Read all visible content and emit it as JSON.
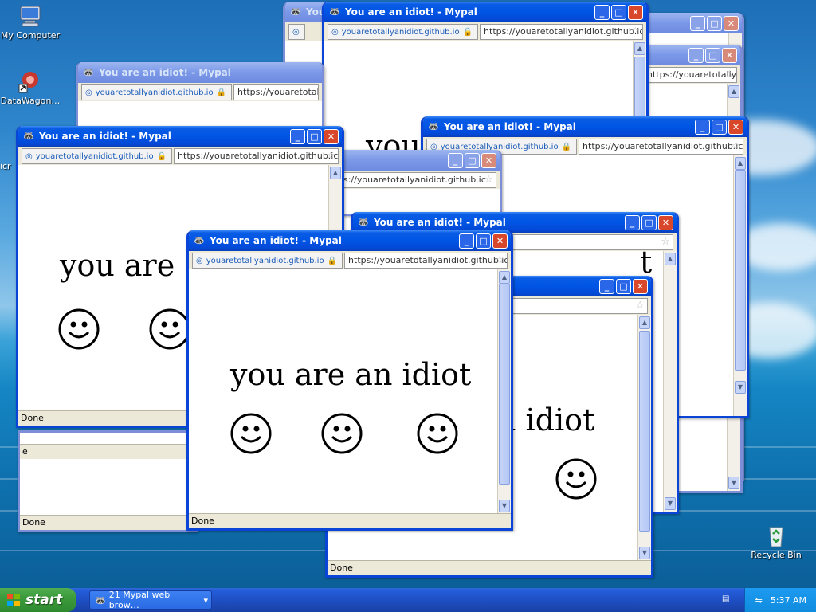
{
  "desktop": {
    "icons": [
      {
        "label": "My Computer"
      },
      {
        "label": "DataWagon…"
      },
      {
        "label": "Micr"
      },
      {
        "label": "Recycle Bin"
      }
    ]
  },
  "window": {
    "title": "You are an idiot! - Mypal",
    "title_truncated": "You",
    "identity": "youaretotallyanidiot.github.io",
    "url": "https://youaretotallyanidiot.github.ic",
    "url_partial": "ps://youaretotallyanidiot.github.ic",
    "headline": "you are an idiot",
    "headline_partial_left": "you are a",
    "headline_partial_right": "n idiot",
    "status": "Done",
    "status_partial": "e"
  },
  "taskbar": {
    "start_label": "start",
    "task_group_label": "21 Mypal web brow…",
    "clock": "5:37 AM"
  },
  "colors": {
    "titlebar_active": "#0055e5",
    "titlebar_inactive": "#7a98e8",
    "taskbar": "#245edb",
    "start_button": "#3c9a3c"
  }
}
